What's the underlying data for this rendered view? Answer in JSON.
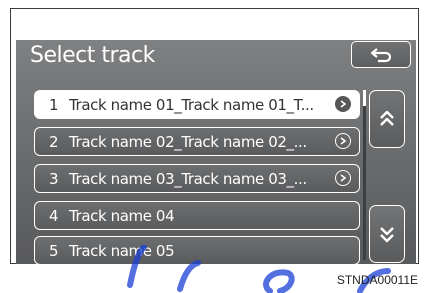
{
  "screen": {
    "title": "Select track",
    "back_icon": "back-arrow-icon"
  },
  "tracks": [
    {
      "number": "1",
      "name": "Track name 01_Track name 01_T...",
      "selected": true,
      "has_more": true
    },
    {
      "number": "2",
      "name": "Track name 02_Track name 02_...",
      "selected": false,
      "has_more": true
    },
    {
      "number": "3",
      "name": "Track name 03_Track name 03_...",
      "selected": false,
      "has_more": true
    },
    {
      "number": "4",
      "name": "Track name 04",
      "selected": false,
      "has_more": false
    },
    {
      "number": "5",
      "name": "Track name 05",
      "selected": false,
      "has_more": false
    }
  ],
  "scroll": {
    "up_icon": "double-chevron-up-icon",
    "down_icon": "double-chevron-down-icon"
  },
  "figure_code": "STNDA00011E",
  "colors": {
    "screen_bg": "#6c6e70",
    "highlight": "#ffffff",
    "watermark": "#1a3fd6"
  }
}
